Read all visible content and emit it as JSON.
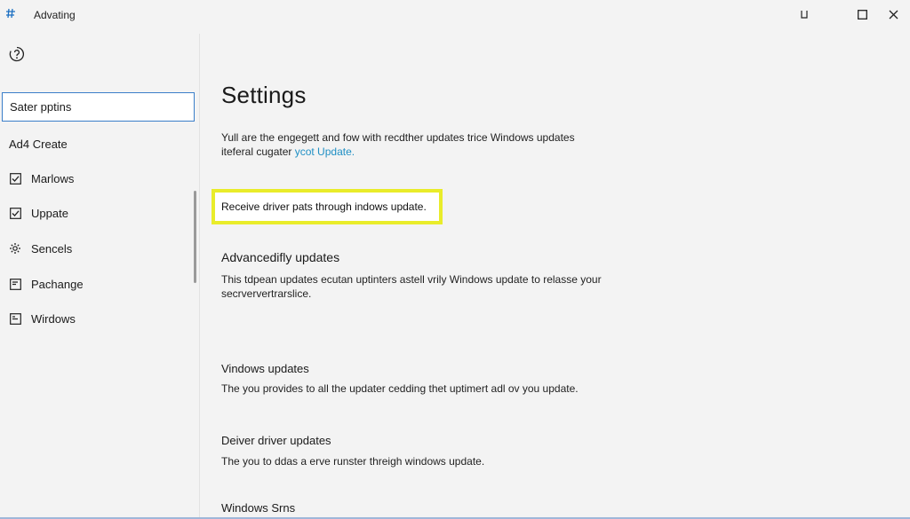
{
  "window": {
    "title": "Advating",
    "icons": {
      "app": "hash-icon",
      "minimize": "minimize-icon",
      "maximize": "maximize-icon",
      "close": "close-icon"
    }
  },
  "sidebar": {
    "help_icon": "help-icon",
    "search_value": "Sater pptins",
    "items": [
      {
        "label": "Ad4 Create",
        "icon": ""
      },
      {
        "label": "Marlows",
        "icon": "checkbox-icon"
      },
      {
        "label": "Uppate",
        "icon": "checkbox-icon"
      },
      {
        "label": "Sencels",
        "icon": "gear-icon"
      },
      {
        "label": "Pachange",
        "icon": "document-icon"
      },
      {
        "label": "Wirdows",
        "icon": "window-icon"
      }
    ]
  },
  "main": {
    "title": "Settings",
    "intro_line1": "Yull are the engegett and fow with recdther updates trice Windows updates",
    "intro_line2_text": "iteferal cugater ",
    "intro_link": "ycot Update.",
    "highlight_option": "Receive driver pats through indows update.",
    "sections": [
      {
        "heading": "Advancedifly updates",
        "line1": "This tdpean updates ecutan uptinters astell vrily Windows update to relasse your",
        "line2": "secrververtrarslice."
      },
      {
        "heading": "Vindows updates",
        "line1": "The you provides to all the updater cedding thet uptimert adl ov you update."
      },
      {
        "heading": "Deiver driver updates",
        "line1": "The you to ddas a erve runster threigh windows update."
      },
      {
        "heading": "Windows Srns"
      }
    ]
  },
  "colors": {
    "accent": "#1b6fc2",
    "link": "#1f8fc4",
    "highlight": "#e9ec2a",
    "search_border": "#3a7ec9"
  }
}
